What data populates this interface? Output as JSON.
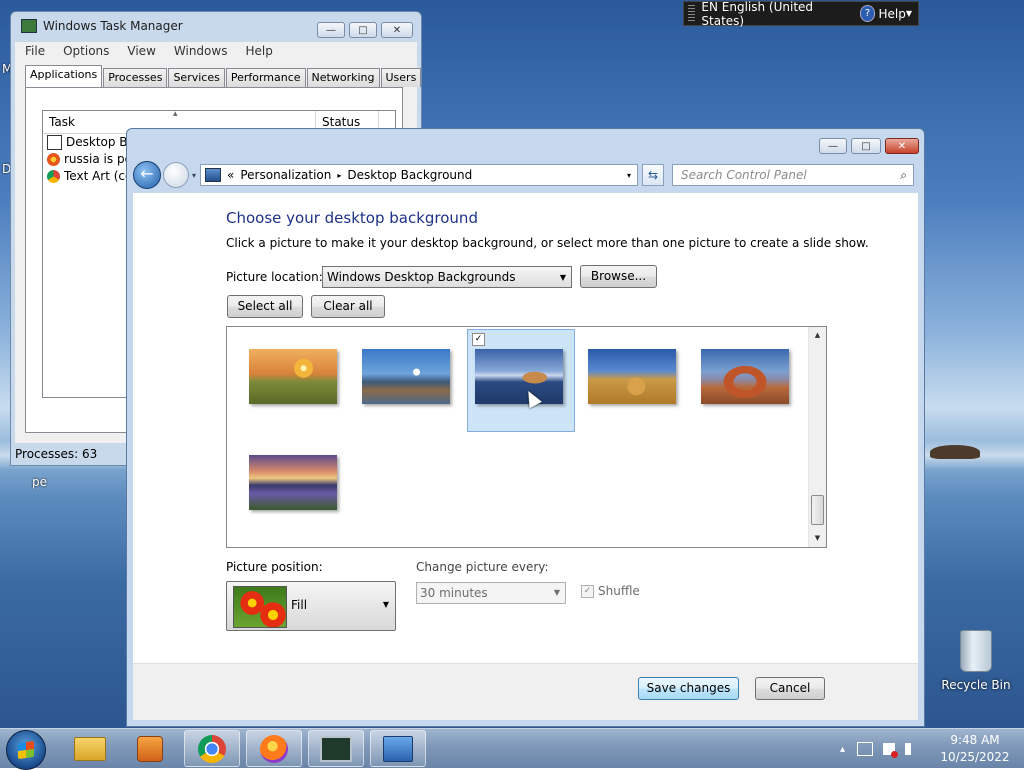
{
  "colors": {
    "heading": "#1e3287",
    "selection": "#cde4f7",
    "default_button": "#a7d9f5"
  },
  "language_bar": {
    "language": "EN English (United States)",
    "help": "Help",
    "help_icon": "?"
  },
  "desktop": {
    "label_m": "M",
    "label_d": "D",
    "label_pe": "pe",
    "recycle_bin": "Recycle Bin"
  },
  "task_manager": {
    "title": "Windows Task Manager",
    "buttons": {
      "minimize": "—",
      "maximize": "□",
      "close": "✕"
    },
    "menu": [
      "File",
      "Options",
      "View",
      "Windows",
      "Help"
    ],
    "tabs": [
      "Applications",
      "Processes",
      "Services",
      "Performance",
      "Networking",
      "Users"
    ],
    "columns": {
      "task": "Task",
      "status": "Status"
    },
    "sort_indicator": "▴",
    "rows": [
      "Desktop Bac",
      "russia is poo",
      "Text Art (cop"
    ],
    "status_bar": "Processes: 63"
  },
  "control_panel": {
    "buttons": {
      "minimize": "—",
      "maximize": "□",
      "close": "✕"
    },
    "nav": {
      "back": "←",
      "dropdown": "▾",
      "refresh": "⇆",
      "prefix": "«"
    },
    "breadcrumb": [
      "Personalization",
      "Desktop Background"
    ],
    "breadcrumb_sep": "▸",
    "address_dropdown": "▾",
    "search_placeholder": "Search Control Panel",
    "search_icon": "⌕",
    "heading": "Choose your desktop background",
    "description": "Click a picture to make it your desktop background, or select more than one picture to create a slide show.",
    "picture_location_label": "Picture location:",
    "picture_location_value": "Windows Desktop Backgrounds",
    "browse_button": "Browse...",
    "select_all_button": "Select all",
    "clear_all_button": "Clear all",
    "selected_thumbnail_check": "✓",
    "scroll_up": "▲",
    "scroll_down": "▼",
    "picture_position_label": "Picture position:",
    "picture_position_value": "Fill",
    "change_picture_label": "Change picture every:",
    "change_picture_value": "30 minutes",
    "shuffle_label": "Shuffle",
    "shuffle_check": "✓",
    "combo_arrow": "▼",
    "save_button": "Save changes",
    "cancel_button": "Cancel"
  },
  "tray": {
    "show_hidden": "▴",
    "time": "9:48 AM",
    "date": "10/25/2022"
  }
}
